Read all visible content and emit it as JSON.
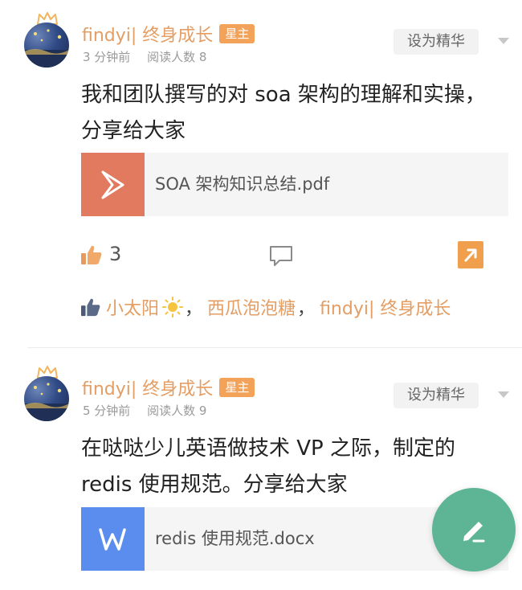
{
  "posts": [
    {
      "author": "findyi| 终身成长",
      "badge": "星主",
      "time": "3 分钟前",
      "reads": "阅读人数 8",
      "feature_label": "设为精华",
      "content": "我和团队撰写的对 soa 架构的理解和实操，分享给大家",
      "attachment": {
        "name": "SOA 架构知识总结.pdf",
        "type": "pdf",
        "color": "#e27a5f"
      },
      "like_count": "3",
      "likers": [
        "小太阳",
        "西瓜泡泡糖",
        "findyi| 终身成长"
      ],
      "separator": "，"
    },
    {
      "author": "findyi| 终身成长",
      "badge": "星主",
      "time": "5 分钟前",
      "reads": "阅读人数 9",
      "feature_label": "设为精华",
      "content": "在哒哒少儿英语做技术 VP 之际，制定的 redis 使用规范。分享给大家",
      "attachment": {
        "name": "redis 使用规范.docx",
        "type": "word",
        "color": "#5b8def"
      }
    }
  ],
  "colors": {
    "author": "#e49d63",
    "badge_bg": "#f3a259",
    "fab": "#5eb595"
  },
  "icons": [
    "crown-icon",
    "like-icon",
    "comment-icon",
    "share-icon",
    "pdf-icon",
    "word-icon",
    "sun-icon",
    "edit-icon",
    "caret-down-icon"
  ]
}
